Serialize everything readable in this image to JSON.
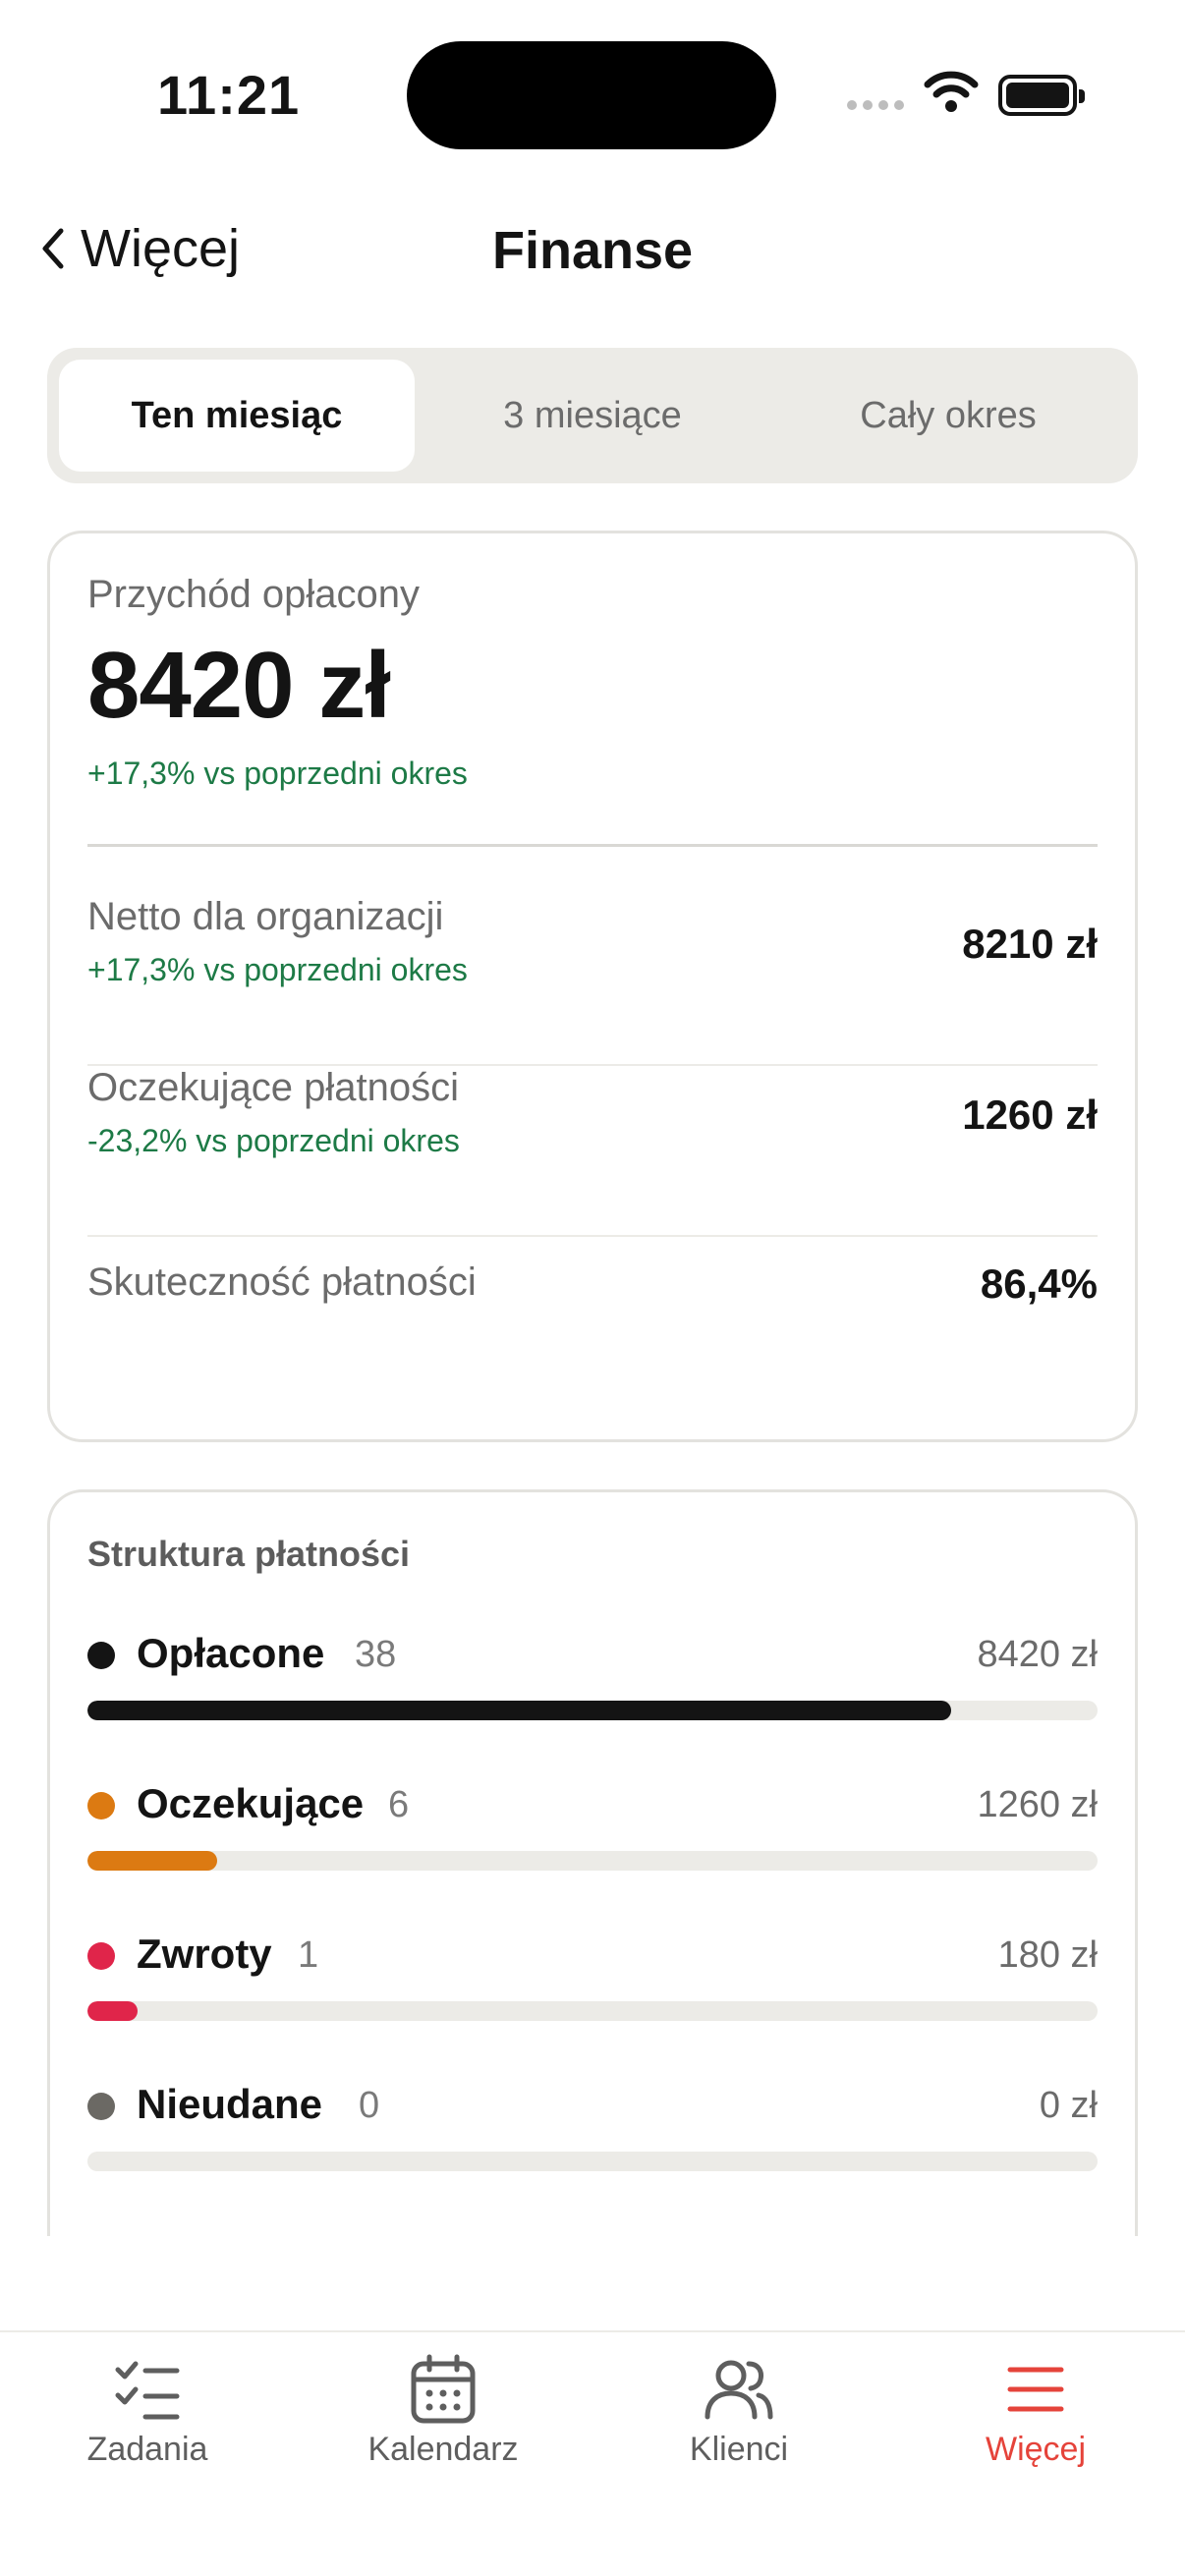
{
  "status": {
    "time": "11:21"
  },
  "nav": {
    "back_label": "Więcej",
    "title": "Finanse"
  },
  "segments": [
    {
      "label": "Ten miesiąc",
      "active": true
    },
    {
      "label": "3 miesiące",
      "active": false
    },
    {
      "label": "Cały okres",
      "active": false
    }
  ],
  "summary": {
    "revenue_label": "Przychód opłacony",
    "revenue_value": "8420 zł",
    "revenue_delta": "+17,3% vs poprzedni okres",
    "metrics": [
      {
        "label": "Netto dla organizacji",
        "delta": "+17,3% vs poprzedni okres",
        "value": "8210 zł"
      },
      {
        "label": "Oczekujące płatności",
        "delta": "-23,2% vs poprzedni okres",
        "value": "1260 zł"
      },
      {
        "label": "Skuteczność płatności",
        "value": "86,4%"
      }
    ]
  },
  "structure": {
    "title": "Struktura płatności",
    "rows": [
      {
        "name": "Opłacone",
        "count": "38",
        "amount": "8420 zł",
        "color": "#141414",
        "fraction": 0.855
      },
      {
        "name": "Oczekujące",
        "count": "6",
        "amount": "1260 zł",
        "color": "#dc7a12",
        "fraction": 0.128
      },
      {
        "name": "Zwroty",
        "count": "1",
        "amount": "180 zł",
        "color": "#e0254a",
        "fraction": 0.05
      },
      {
        "name": "Nieudane",
        "count": "0",
        "amount": "0 zł",
        "color": "#6b6964",
        "fraction": 0.0
      }
    ]
  },
  "tabbar": {
    "items": [
      {
        "label": "Zadania",
        "icon": "checklist-icon",
        "active": false
      },
      {
        "label": "Kalendarz",
        "icon": "calendar-icon",
        "active": false
      },
      {
        "label": "Klienci",
        "icon": "users-icon",
        "active": false
      },
      {
        "label": "Więcej",
        "icon": "menu-icon",
        "active": true
      }
    ],
    "accent": "#e5433a"
  }
}
